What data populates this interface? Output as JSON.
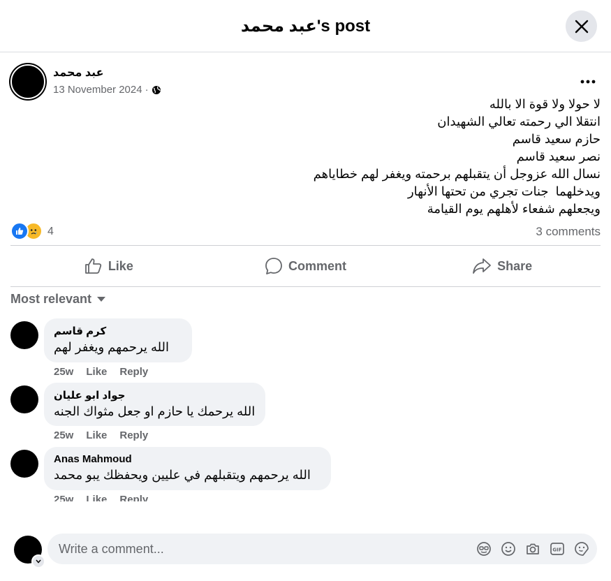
{
  "header": {
    "title": "عبد محمد's post"
  },
  "post": {
    "author": "عبد محمد",
    "date": "13 November 2024",
    "separator": "·",
    "lines": [
      "لا حولا ولا قوة الا بالله",
      "انتقلا الي رحمته تعالي الشهيدان",
      "حازم سعيد قاسم",
      "نصر سعيد قاسم",
      "نسال الله عزوجل أن يتقبلهم برحمته ويغفر لهم خطاياهم",
      "ويدخلهما  جنات تجري من تحتها الأنهار",
      "ويجعلهم شفعاء لأهلهم يوم القيامة"
    ],
    "reaction_count": "4",
    "comments_count": "3 comments"
  },
  "actions": {
    "like": "Like",
    "comment": "Comment",
    "share": "Share"
  },
  "sort": {
    "label": "Most relevant"
  },
  "comments": [
    {
      "name": "كرم قاسم",
      "text": "الله يرحمهم ويغفر لهم",
      "time": "25w",
      "like": "Like",
      "reply": "Reply"
    },
    {
      "name": "جواد ابو عليان",
      "text": "الله يرحمك يا حازم او جعل مثواك الجنه",
      "time": "25w",
      "like": "Like",
      "reply": "Reply"
    },
    {
      "name": "Anas Mahmoud",
      "text": "الله يرحمهم ويتقبلهم في عليين ويحفظك يبو محمد",
      "time": "25w",
      "like": "Like",
      "reply": "Reply"
    }
  ],
  "composer": {
    "placeholder": "Write a comment..."
  },
  "colors": {
    "accent": "#1877f2",
    "muted": "#65676b",
    "bubble": "#f0f2f5",
    "sad": "#f7b928"
  },
  "icons": [
    "close-icon",
    "globe-icon",
    "more-icon",
    "like-reaction-icon",
    "sad-reaction-icon",
    "thumbs-up-icon",
    "comment-icon",
    "share-icon",
    "caret-down-icon",
    "avatar-sticker-icon",
    "emoji-icon",
    "camera-icon",
    "gif-icon",
    "sticker-icon"
  ]
}
